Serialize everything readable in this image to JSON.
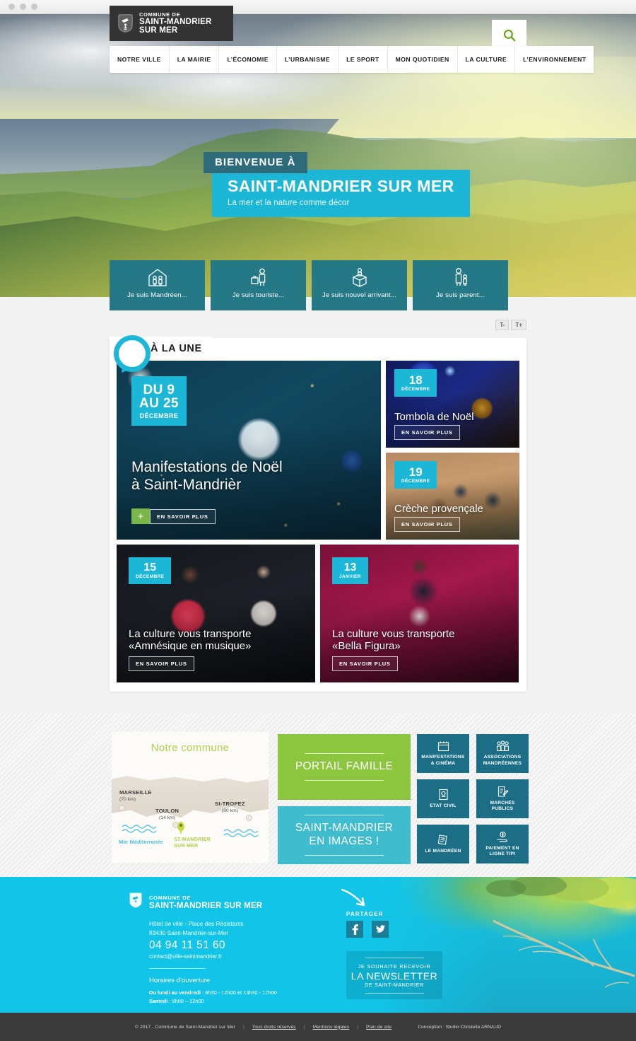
{
  "browser": {
    "dots": 3
  },
  "header": {
    "logo": {
      "crest_icon": "coat-of-arms-icon",
      "small": "COMMUNE DE",
      "big_line1": "SAINT-MANDRIER",
      "big_line2": "SUR MER"
    },
    "search": {
      "icon": "search-icon",
      "accent": "#6aa617"
    },
    "nav": [
      {
        "label": "NOTRE VILLE"
      },
      {
        "label": "LA MAIRIE"
      },
      {
        "label": "L’ÉCONOMIE"
      },
      {
        "label": "L’URBANISME"
      },
      {
        "label": "LE SPORT"
      },
      {
        "label": "MON QUOTIDIEN"
      },
      {
        "label": "LA CULTURE"
      },
      {
        "label": "L’ENVIRONNEMENT"
      }
    ]
  },
  "hero": {
    "kicker": "BIENVENUE À",
    "title": "SAINT-MANDRIER SUR MER",
    "subtitle": "La mer et la nature comme décor",
    "kicker_bg": "#2e6b7a",
    "title_bg": "#1cb7d6"
  },
  "quick_tiles": [
    {
      "icon": "house-family-icon",
      "label": "Je suis Mandréen..."
    },
    {
      "icon": "tourist-suitcase-icon",
      "label": "Je suis touriste..."
    },
    {
      "icon": "moving-box-icon",
      "label": "Je suis nouvel arrivant..."
    },
    {
      "icon": "parent-child-icon",
      "label": "Je suis parent..."
    }
  ],
  "text_size": {
    "decrease": "T-",
    "increase": "T+"
  },
  "alaune": {
    "bubble_icon": "speech-bubble-icon",
    "title": "À LA UNE",
    "cards": [
      {
        "id": "manifestations-noel",
        "date_num": "DU 9\nAU 25",
        "date_num_l1": "DU 9",
        "date_num_l2": "AU 25",
        "date_month": "DÉCEMBRE",
        "title_l1": "Manifestations de Noël",
        "title_l2": "à Saint-Mandrièr",
        "button": "EN SAVOIR PLUS",
        "plus": "+"
      },
      {
        "id": "tombola-noel",
        "date_num": "18",
        "date_month": "DÉCEMBRE",
        "title_l1": "Tombola de Noël",
        "button": "EN SAVOIR PLUS"
      },
      {
        "id": "creche-provencale",
        "date_num": "19",
        "date_month": "DÉCEMBRE",
        "title_l1": "Crèche provençale",
        "button": "EN SAVOIR PLUS"
      },
      {
        "id": "amnesique-en-musique",
        "date_num": "15",
        "date_month": "DÉCEMBRE",
        "title_l1": "La culture vous transporte",
        "title_l2": "«Amnésique en musique»",
        "button": "EN SAVOIR PLUS"
      },
      {
        "id": "bella-figura",
        "date_num": "13",
        "date_month": "JANVIER",
        "title_l1": "La culture vous transporte",
        "title_l2": "«Bella Figura»",
        "button": "EN SAVOIR PLUS"
      }
    ]
  },
  "map": {
    "title": "Notre commune",
    "title_color": "#b2cf4e",
    "cities": [
      {
        "name": "MARSEILLE",
        "distance": "(70 km)"
      },
      {
        "name": "TOULON",
        "distance": "(14 km)"
      },
      {
        "name": "St-TROPEZ",
        "distance": "(80 km)"
      }
    ],
    "sea_label": "Mer Méditerranée",
    "pin_label_l1": "ST-MANDRIER",
    "pin_label_l2": "SUR MER"
  },
  "big_buttons": [
    {
      "label": "PORTAIL FAMILLE",
      "color": "#8cc63e"
    },
    {
      "label_l1": "SAINT-MANDRIER",
      "label_l2": "EN IMAGES !",
      "color": "#3fbccd"
    }
  ],
  "services": [
    {
      "icon": "calendar-icon",
      "label_l1": "MANIFESTATIONS",
      "label_l2": "& CINÉMA"
    },
    {
      "icon": "people-group-icon",
      "label_l1": "ASSOCIATIONS",
      "label_l2": "MANDRÉENNES"
    },
    {
      "icon": "passport-icon",
      "label_l1": "ETAT CIVIL",
      "label_l2": ""
    },
    {
      "icon": "contract-pen-icon",
      "label_l1": "MARCHÉS",
      "label_l2": "PUBLICS"
    },
    {
      "icon": "newspaper-icon",
      "label_l1": "LE MANDRÉEN",
      "label_l2": ""
    },
    {
      "icon": "coin-hand-icon",
      "label_l1": "PAIEMENT EN",
      "label_l2": "LIGNE TIPI"
    }
  ],
  "footer": {
    "crest_icon": "coat-of-arms-icon",
    "commune_small": "COMMUNE DE",
    "commune_big": "SAINT-MANDRIER SUR MER",
    "address_l1": "Hôtel de ville - Place des Résistants",
    "address_l2": "83430 Saint-Mandrier-sur-Mer",
    "phone": "04 94 11 51 60",
    "email": "contact@ville-saintmandrier.fr",
    "hours_title": "Horaires d’ouverture",
    "hours_l1_bold": "Du lundi au vendredi",
    "hours_l1_rest": " : 8h30 - 12h00 et 13h30 - 17h00",
    "hours_l2_bold": "Samedi",
    "hours_l2_rest": " : 9h00 – 12h00",
    "share_label": "PARTAGER",
    "socials": [
      {
        "icon": "facebook-icon",
        "name": "Facebook"
      },
      {
        "icon": "twitter-icon",
        "name": "Twitter"
      }
    ],
    "arrow_icon": "curved-arrow-icon",
    "newsletter_l1": "JE SOUHAITE RECEVOIR",
    "newsletter_l2": "LA NEWSLETTER",
    "newsletter_l3": "DE SAINT-MANDRIER",
    "bg_color": "#12c5e8"
  },
  "bottom_bar": {
    "copyright": "© 2017 - Commune de Saint-Mandrier sur Mer",
    "sep": "|",
    "link1": "Tous droits réservés",
    "link2": "Mentions légales",
    "link3": "Plan de site",
    "credit": "Conception : Studio Christelle ARNAUD"
  }
}
